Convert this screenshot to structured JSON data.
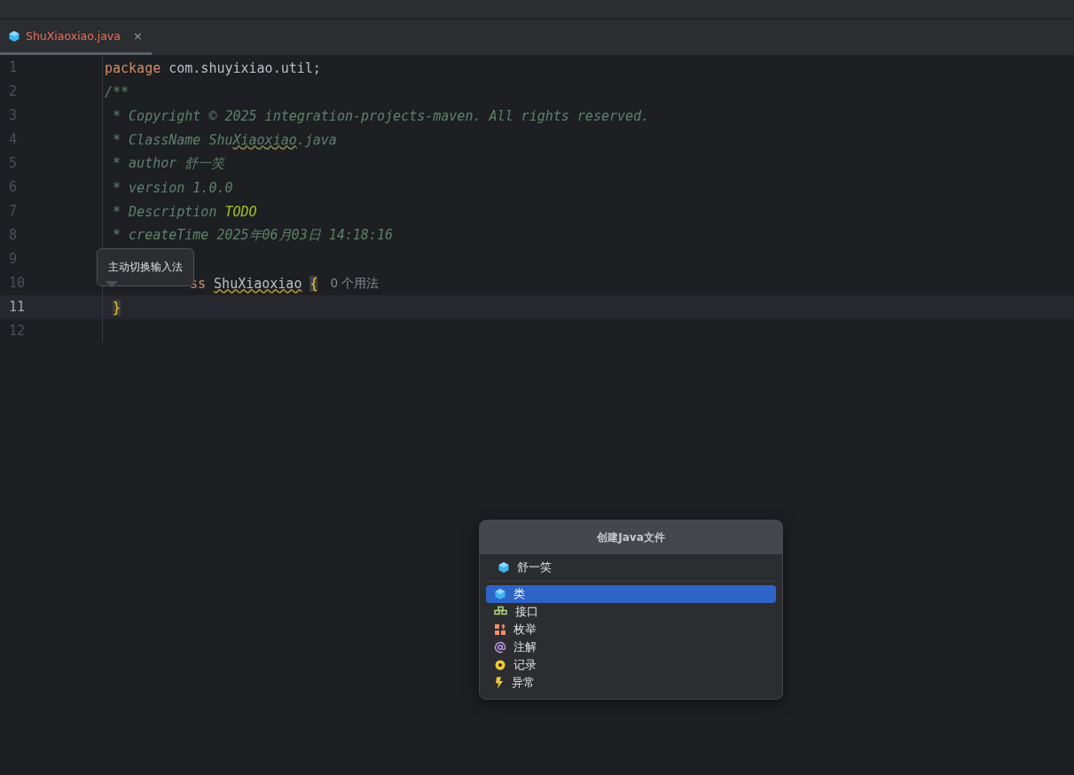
{
  "tabs": [
    {
      "label": "ShuXiaoxiao.java",
      "selected": true,
      "close": "×"
    }
  ],
  "lines": [
    {
      "number": "1",
      "current": false,
      "covered": false,
      "tokens": [
        {
          "kind": "kw",
          "text": "package"
        },
        {
          "kind": "plain",
          "text": " com.shuyixiao.util;"
        }
      ]
    },
    {
      "number": "2",
      "current": false,
      "covered": false,
      "tokens": [
        {
          "kind": "comment",
          "text": "/**"
        }
      ]
    },
    {
      "number": "3",
      "current": false,
      "covered": false,
      "tokens": [
        {
          "kind": "comment",
          "text": " * Copyright © 2025 integration-projects-maven. All rights reserved."
        }
      ]
    },
    {
      "number": "4",
      "current": false,
      "covered": false,
      "tokens": [
        {
          "kind": "comment",
          "text": " * ClassName Shu"
        },
        {
          "kind": "comment-typo",
          "text": "Xiaoxiao"
        },
        {
          "kind": "comment",
          "text": ".java"
        }
      ]
    },
    {
      "number": "5",
      "current": false,
      "covered": false,
      "tokens": [
        {
          "kind": "comment",
          "text": " * author 舒一笑"
        }
      ]
    },
    {
      "number": "6",
      "current": false,
      "covered": false,
      "tokens": [
        {
          "kind": "comment",
          "text": " * version 1.0.0"
        }
      ]
    },
    {
      "number": "7",
      "current": false,
      "covered": false,
      "tokens": [
        {
          "kind": "comment",
          "text": " * Description "
        },
        {
          "kind": "todo",
          "text": "TODO"
        }
      ]
    },
    {
      "number": "8",
      "current": false,
      "covered": false,
      "tokens": [
        {
          "kind": "comment",
          "text": " * createTime 2025年06月03日 14:18:16"
        }
      ]
    },
    {
      "number": "9",
      "current": false,
      "covered": false
    },
    {
      "number": "10",
      "current": false,
      "covered": true,
      "tokens": [
        {
          "kind": "kw",
          "text": "ss"
        },
        {
          "kind": "typo",
          "text": "ShuXiaoxiao"
        },
        {
          "kind": "brace",
          "text": "{"
        },
        {
          "kind": "hint",
          "text": "0 个用法"
        }
      ]
    },
    {
      "number": "11",
      "current": true,
      "covered": false,
      "tokens": [
        {
          "kind": "brace",
          "text": "}"
        }
      ]
    },
    {
      "number": "12",
      "current": false,
      "covered": false
    }
  ],
  "tooltip": "主动切换输入法",
  "popup": {
    "title": "创建Java文件",
    "name": "舒一笑",
    "items": [
      {
        "label": "类",
        "kind": "class",
        "selected": true
      },
      {
        "label": "接口",
        "kind": "interface",
        "selected": false
      },
      {
        "label": "枚举",
        "kind": "enum",
        "selected": false
      },
      {
        "label": "注解",
        "kind": "annotation",
        "selected": false
      },
      {
        "label": "记录",
        "kind": "record",
        "selected": false
      },
      {
        "label": "异常",
        "kind": "exception",
        "selected": false
      }
    ]
  }
}
